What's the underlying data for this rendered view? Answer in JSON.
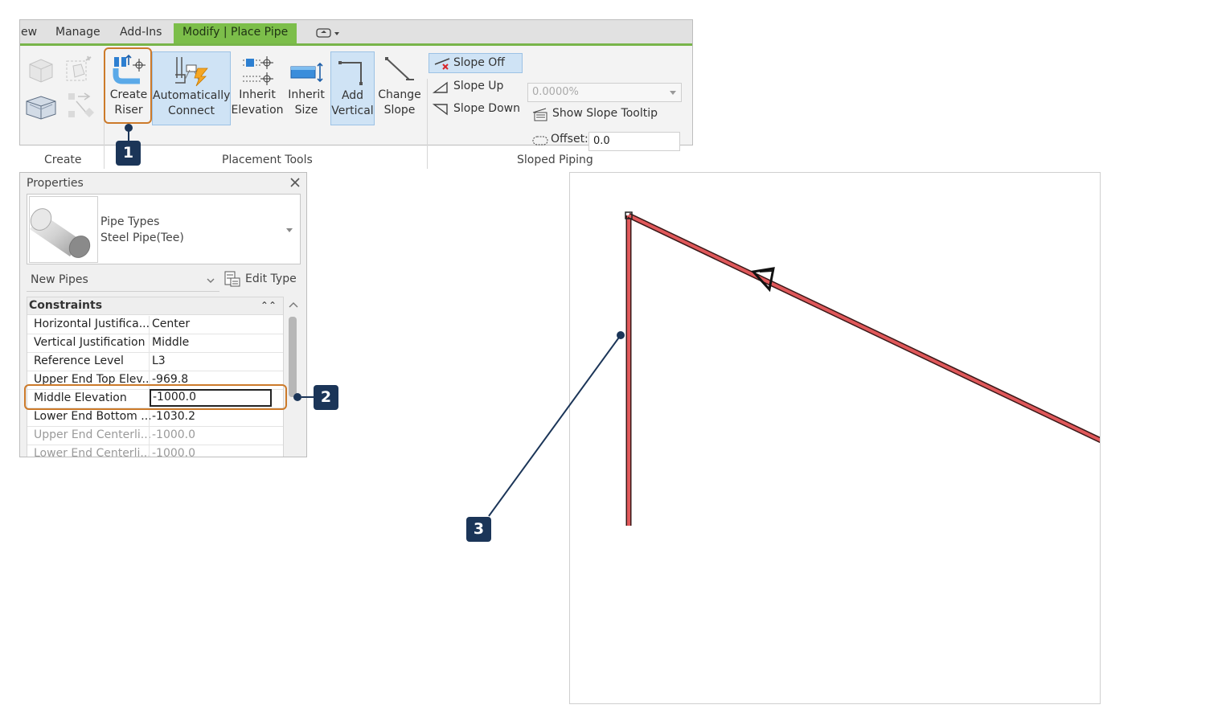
{
  "ribbon": {
    "tabs": [
      "ew",
      "Manage",
      "Add-Ins",
      "Modify | Place Pipe"
    ],
    "active_tab": "Modify | Place Pipe",
    "create_panel_label": "Create",
    "placement_tools_label": "Placement Tools",
    "sloped_piping_label": "Sloped Piping",
    "buttons": {
      "create_riser": [
        "Create",
        "Riser"
      ],
      "auto_connect": [
        "Automatically",
        "Connect"
      ],
      "inherit_elevation": [
        "Inherit",
        "Elevation"
      ],
      "inherit_size": [
        "Inherit",
        "Size"
      ],
      "add_vertical": [
        "Add",
        "Vertical"
      ],
      "change_slope": [
        "Change",
        "Slope"
      ]
    },
    "slope_off": "Slope Off",
    "slope_up": "Slope Up",
    "slope_down": "Slope Down",
    "slope_value": "0.0000%",
    "show_slope_tooltip": "Show Slope Tooltip",
    "offset_label": "Offset:",
    "offset_value": "0.0"
  },
  "properties": {
    "title": "Properties",
    "type_family": "Pipe Types",
    "type_name": "Steel Pipe(Tee)",
    "instance_filter": "New Pipes",
    "edit_type": "Edit Type",
    "group": "Constraints",
    "rows": [
      {
        "key": "Horizontal Justifica...",
        "value": "Center",
        "disabled": false
      },
      {
        "key": "Vertical Justification",
        "value": "Middle",
        "disabled": false
      },
      {
        "key": "Reference Level",
        "value": "L3",
        "disabled": false
      },
      {
        "key": "Upper End Top Elev...",
        "value": "-969.8",
        "disabled": false
      },
      {
        "key": "Middle Elevation",
        "value": "-1000.0",
        "disabled": false
      },
      {
        "key": "Lower End Bottom ...",
        "value": "-1030.2",
        "disabled": false
      },
      {
        "key": "Upper End Centerli...",
        "value": "-1000.0",
        "disabled": true
      },
      {
        "key": "Lower End Centerli...",
        "value": "-1000.0",
        "disabled": true
      }
    ]
  },
  "callouts": [
    "1",
    "2",
    "3"
  ],
  "colors": {
    "accent_tab": "#7cbe4a",
    "callout_orange": "#cc7a2a",
    "badge_navy": "#1b3558",
    "pipe_red": "#e0585a"
  }
}
